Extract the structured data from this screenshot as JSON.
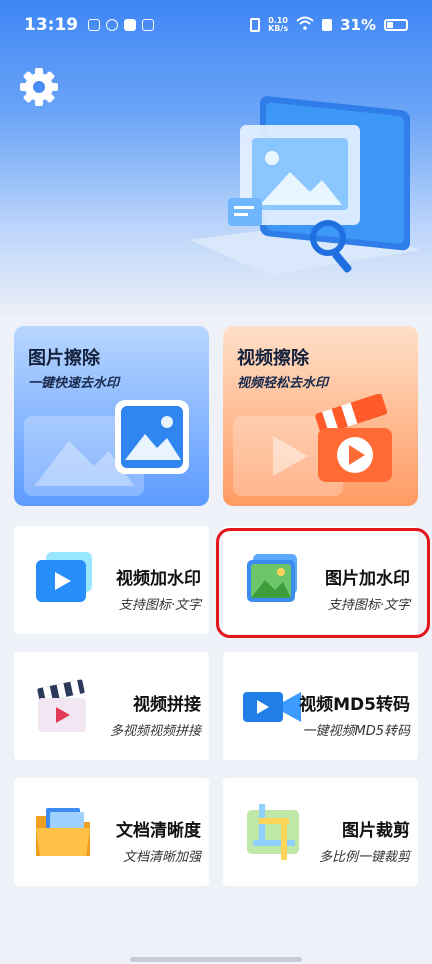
{
  "status": {
    "time": "13:19",
    "speed_top": "0.10",
    "speed_bottom": "KB/s",
    "battery": "31%"
  },
  "header": {
    "settings_icon": "gear-icon"
  },
  "cards_big": [
    {
      "title": "图片擦除",
      "subtitle": "一键快速去水印",
      "icon": "image-frame-icon"
    },
    {
      "title": "视频擦除",
      "subtitle": "视频轻松去水印",
      "icon": "clapper-play-icon"
    }
  ],
  "cards": [
    {
      "title": "视频加水印",
      "subtitle": "支持图标·文字",
      "icon": "video-stack-icon"
    },
    {
      "title": "图片加水印",
      "subtitle": "支持图标·文字",
      "icon": "picture-stack-icon"
    },
    {
      "title": "视频拼接",
      "subtitle": "多视频视频拼接",
      "icon": "clapperboard-icon"
    },
    {
      "title": "视频MD5转码",
      "subtitle": "一键视频MD5转码",
      "icon": "video-camera-icon"
    },
    {
      "title": "文档清晰度",
      "subtitle": "文档清晰加强",
      "icon": "folder-icon"
    },
    {
      "title": "图片裁剪",
      "subtitle": "多比例一键裁剪",
      "icon": "crop-icon"
    }
  ],
  "colors": {
    "accent_blue": "#3f86f5",
    "highlight_red": "#e3161c",
    "card_orange": "#ff9a62"
  }
}
